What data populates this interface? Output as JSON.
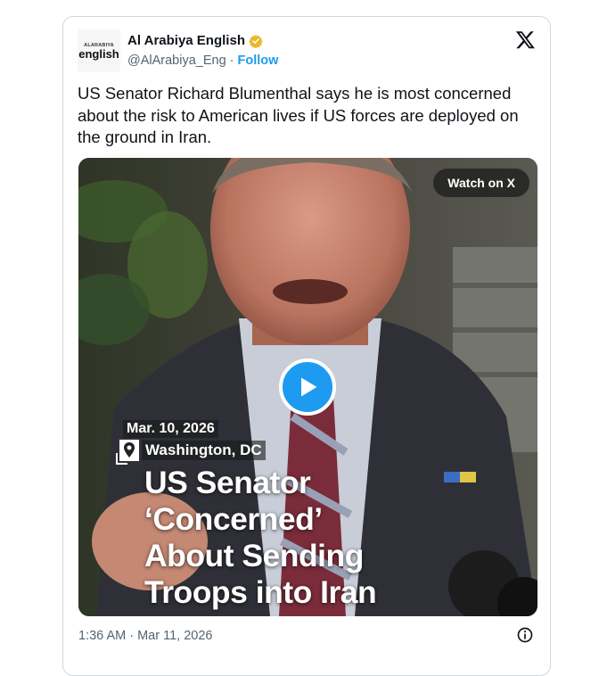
{
  "account": {
    "avatar_line1": "ALARABIYA",
    "avatar_line2": "english",
    "display_name": "Al Arabiya English",
    "handle": "@AlArabiya_Eng",
    "separator": "·",
    "follow_label": "Follow",
    "verified_color": "#e8b92c"
  },
  "tweet": {
    "text": "US Senator Richard Blumenthal says he is most concerned about the risk to American lives if US forces are deployed on the ground in Iran.",
    "timestamp": "1:36 AM · Mar 11, 2026"
  },
  "media": {
    "watch_label": "Watch on X",
    "date": "Mar. 10, 2026",
    "location": "Washington, DC",
    "headline": [
      "US Senator",
      "‘Concerned’",
      "About Sending",
      "Troops into Iran"
    ],
    "play_icon": "play-icon"
  },
  "colors": {
    "accent": "#1d9bf0",
    "text": "#0f1419",
    "muted": "#536471",
    "border": "#cfd9de"
  }
}
